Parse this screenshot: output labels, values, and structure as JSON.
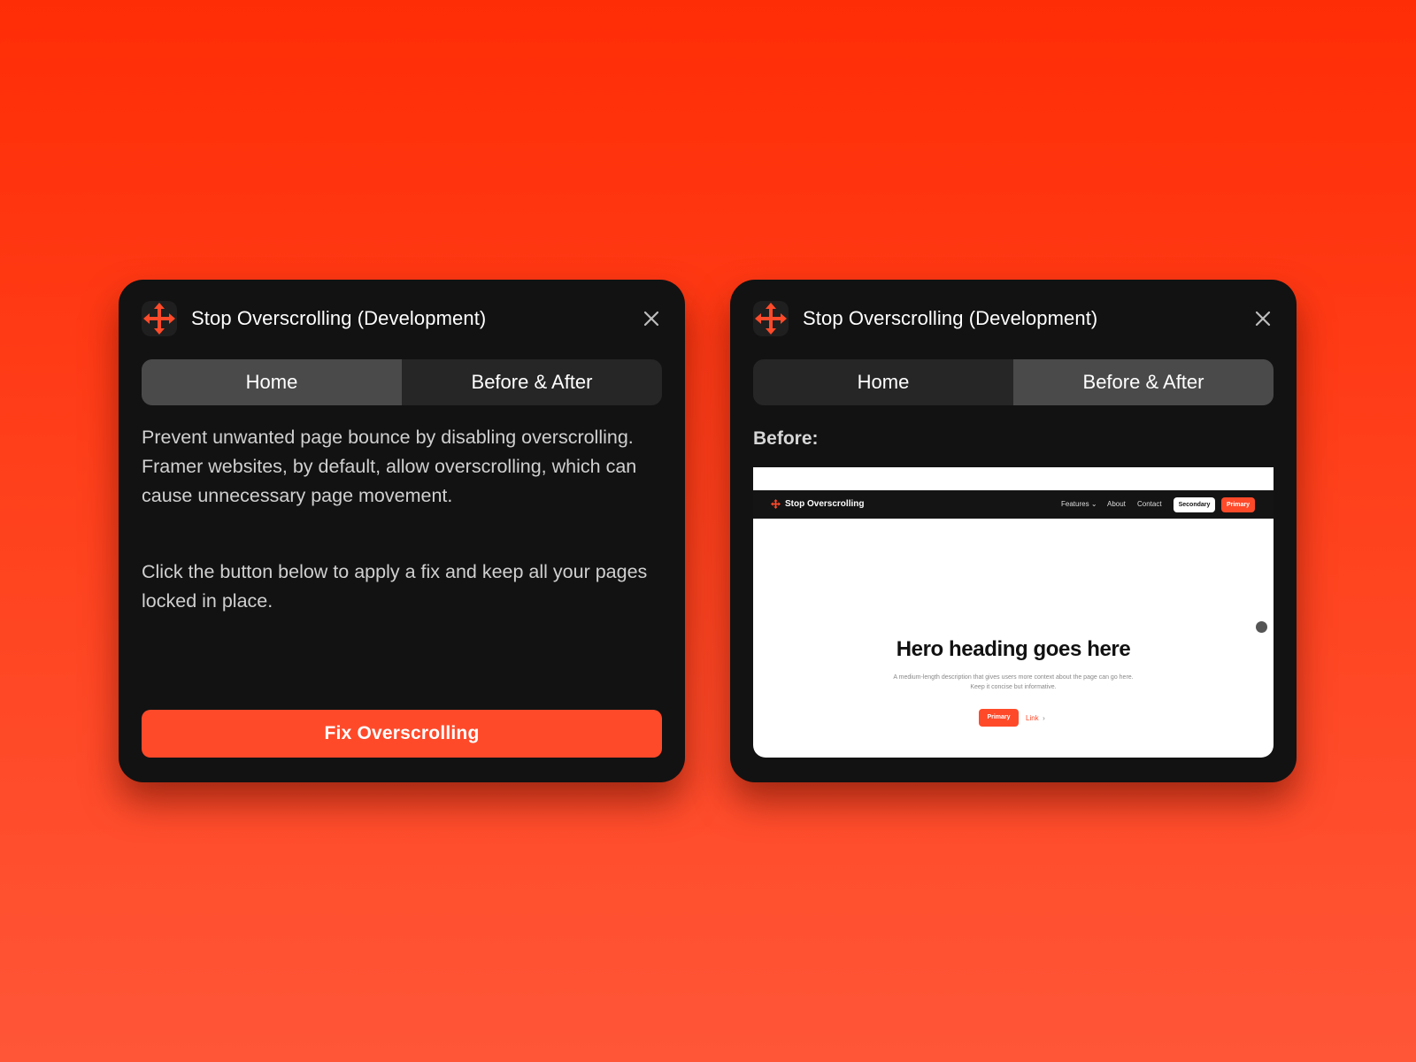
{
  "colors": {
    "accent": "#ff4a2a",
    "panel_bg": "#121212",
    "tab_track": "#262626",
    "tab_active": "#4a4a4a"
  },
  "left_panel": {
    "app_icon": "move-arrows-icon",
    "title": "Stop Overscrolling (Development)",
    "close_icon": "close-icon",
    "tabs": [
      {
        "label": "Home",
        "active": true
      },
      {
        "label": "Before & After",
        "active": false
      }
    ],
    "paragraphs": [
      "Prevent unwanted page bounce by disabling overscrolling. Framer websites, by default, allow overscrolling, which can cause unnecessary page movement.",
      "Click the button below to apply a fix and keep all your pages locked in place."
    ],
    "fix_button_label": "Fix Overscrolling"
  },
  "right_panel": {
    "app_icon": "move-arrows-icon",
    "title": "Stop Overscrolling (Development)",
    "close_icon": "close-icon",
    "tabs": [
      {
        "label": "Home",
        "active": false
      },
      {
        "label": "Before & After",
        "active": true
      }
    ],
    "before_label": "Before:",
    "preview": {
      "brand": "Stop Overscrolling",
      "nav_links": [
        "Features",
        "About",
        "Contact"
      ],
      "nav_secondary": "Secondary",
      "nav_primary": "Primary",
      "hero_heading": "Hero heading goes here",
      "hero_description": "A medium-length description that gives users more context about the page can go here. Keep it concise but informative.",
      "hero_primary": "Primary",
      "hero_link": "Link"
    }
  }
}
